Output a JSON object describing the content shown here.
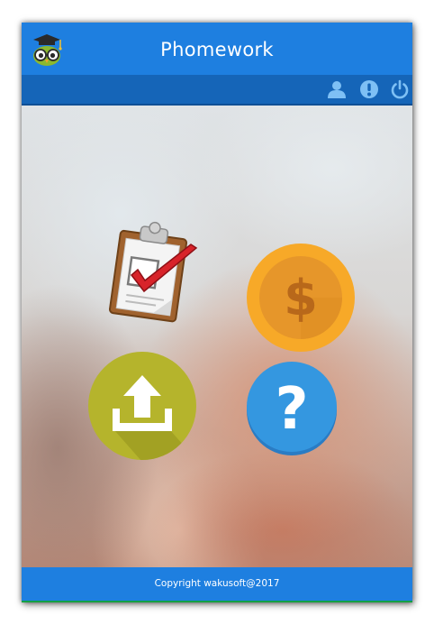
{
  "app": {
    "title": "Phomework",
    "logo": "owl-graduate-icon"
  },
  "toolbar": {
    "icons": [
      "user-icon",
      "info-icon",
      "power-icon"
    ]
  },
  "menu": {
    "tiles": [
      {
        "name": "homework-checklist",
        "icon": "clipboard-check-icon"
      },
      {
        "name": "payment",
        "icon": "dollar-coin-icon"
      },
      {
        "name": "upload",
        "icon": "upload-icon"
      },
      {
        "name": "help",
        "icon": "question-icon"
      }
    ]
  },
  "footer": {
    "copyright": "Copyright wakusoft@2017"
  },
  "colors": {
    "header": "#1e7fe0",
    "subbar": "#1565b8",
    "coin": "#f7a928",
    "upload": "#b5b42c",
    "help": "#3497e0"
  }
}
